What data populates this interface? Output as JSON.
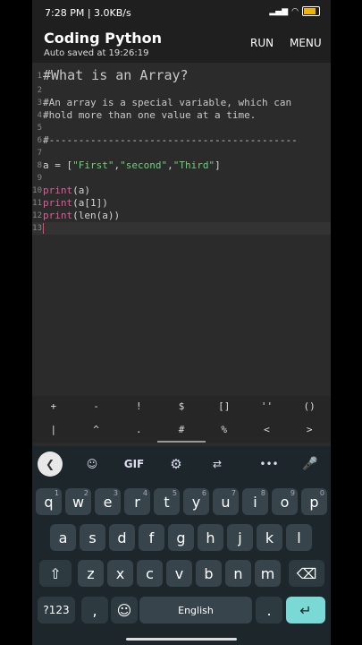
{
  "status": {
    "time": "7:28 PM | 3.0KB/s",
    "battery_pct": 80
  },
  "app": {
    "title": "Coding Python",
    "subtitle": "Auto saved at 19:26:19",
    "run": "RUN",
    "menu": "MENU"
  },
  "editor": {
    "lines": [
      {
        "n": "1",
        "text": "#What is an Array?"
      },
      {
        "n": "2",
        "text": ""
      },
      {
        "n": "3",
        "text": "#An array is a special variable, which can"
      },
      {
        "n": "4",
        "text": "#hold more than one value at a time."
      },
      {
        "n": "5",
        "text": ""
      },
      {
        "n": "6",
        "text": "#------------------------------------------"
      },
      {
        "n": "7",
        "text": ""
      },
      {
        "n": "8",
        "text": "a = [\"First\",\"second\",\"Third\"]"
      },
      {
        "n": "9",
        "text": ""
      },
      {
        "n": "10",
        "text": "print(a)"
      },
      {
        "n": "11",
        "text": "print(a[1])"
      },
      {
        "n": "12",
        "text": "print(len(a))"
      },
      {
        "n": "13",
        "text": ""
      }
    ]
  },
  "symbols": {
    "row1": [
      "+",
      "-",
      "!",
      "$",
      "[]",
      "''",
      "()"
    ],
    "row2": [
      "|",
      "^",
      ".",
      "#",
      "%",
      "<",
      ">"
    ]
  },
  "keyboard": {
    "toolbar": {
      "gif": "GIF"
    },
    "row1": [
      {
        "k": "q",
        "h": "1"
      },
      {
        "k": "w",
        "h": "2"
      },
      {
        "k": "e",
        "h": "3"
      },
      {
        "k": "r",
        "h": "4"
      },
      {
        "k": "t",
        "h": "5"
      },
      {
        "k": "y",
        "h": "6"
      },
      {
        "k": "u",
        "h": "7"
      },
      {
        "k": "i",
        "h": "8"
      },
      {
        "k": "o",
        "h": "9"
      },
      {
        "k": "p",
        "h": "0"
      }
    ],
    "row2": [
      "a",
      "s",
      "d",
      "f",
      "g",
      "h",
      "j",
      "k",
      "l"
    ],
    "row3": [
      "z",
      "x",
      "c",
      "v",
      "b",
      "n",
      "m"
    ],
    "sym_key": "?123",
    "comma": ",",
    "space": "English",
    "period": "."
  }
}
